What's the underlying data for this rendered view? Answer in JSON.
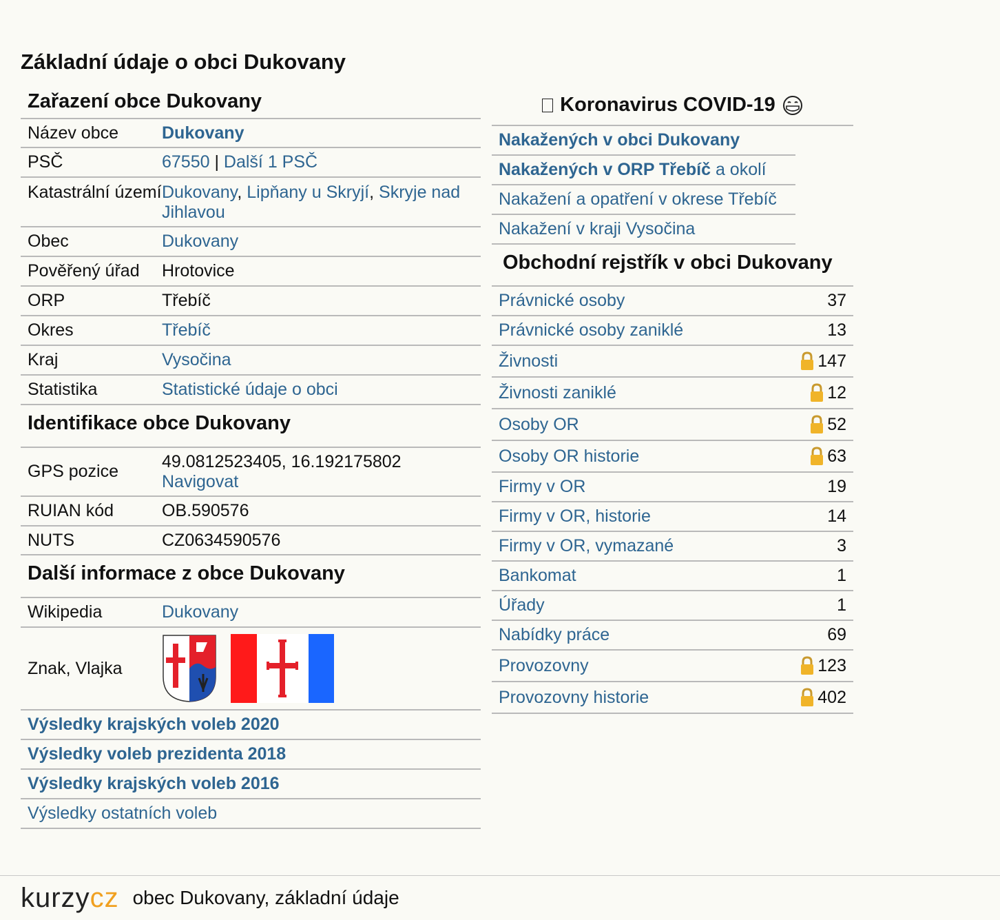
{
  "page_title": "Základní údaje o obci Dukovany",
  "zarazeni": {
    "heading": "Zařazení obce Dukovany",
    "rows": {
      "nazev": {
        "label": "Název obce",
        "value": "Dukovany"
      },
      "psc": {
        "label": "PSČ",
        "code": "67550",
        "sep": " | ",
        "more": "Další 1 PSČ"
      },
      "katastr": {
        "label": "Katastrální území",
        "a": "Dukovany",
        "b": "Lipňany u Skryjí",
        "c": "Skryje nad Jihlavou"
      },
      "obec": {
        "label": "Obec",
        "value": "Dukovany"
      },
      "poverany": {
        "label": "Pověřený úřad",
        "value": "Hrotovice"
      },
      "orp": {
        "label": "ORP",
        "value": "Třebíč"
      },
      "okres": {
        "label": "Okres",
        "value": "Třebíč"
      },
      "kraj": {
        "label": "Kraj",
        "value": "Vysočina"
      },
      "statistika": {
        "label": "Statistika",
        "value": "Statistické údaje o obci"
      }
    }
  },
  "identifikace": {
    "heading": "Identifikace obce Dukovany",
    "gps": {
      "label": "GPS pozice",
      "coords": "49.0812523405, 16.192175802",
      "link": "Navigovat"
    },
    "ruian": {
      "label": "RUIAN kód",
      "value": "OB.590576"
    },
    "nuts": {
      "label": "NUTS",
      "value": "CZ0634590576"
    }
  },
  "dalsi": {
    "heading": "Další informace z obce Dukovany",
    "wikipedia": {
      "label": "Wikipedia",
      "value": "Dukovany"
    },
    "znak": {
      "label": "Znak, Vlajka"
    }
  },
  "volby": {
    "v2020": "Výsledky krajských voleb 2020",
    "v2018": "Výsledky voleb prezidenta 2018",
    "v2016": "Výsledky krajských voleb 2016",
    "ostatni": "Výsledky ostatních voleb"
  },
  "covid": {
    "heading": "Koronavirus COVID-19",
    "icon": "face-with-medical-mask",
    "links": {
      "l1": "Nakažených v obci Dukovany",
      "l2_bold": "Nakažených v ORP Třebíč",
      "l2_rest": " a okolí",
      "l3": "Nakažení a opatření v okrese Třebíč",
      "l4": "Nakažení v kraji Vysočina"
    }
  },
  "rejstrik": {
    "heading": "Obchodní rejstřík v obci Dukovany",
    "rows": [
      {
        "label": "Právnické osoby",
        "count": "37"
      },
      {
        "label": "Právnické osoby zaniklé",
        "count": "13"
      },
      {
        "label": "Živnosti",
        "count": "147",
        "locked": true
      },
      {
        "label": "Živnosti zaniklé",
        "count": "12",
        "locked": true
      },
      {
        "label": "Osoby OR",
        "count": "52",
        "locked": true
      },
      {
        "label": "Osoby OR historie",
        "count": "63",
        "locked": true
      },
      {
        "label": "Firmy v OR",
        "count": "19"
      },
      {
        "label": "Firmy v OR, historie",
        "count": "14"
      },
      {
        "label": "Firmy v OR, vymazané",
        "count": "3"
      },
      {
        "label": "Bankomat",
        "count": "1"
      },
      {
        "label": "Úřady",
        "count": "1"
      },
      {
        "label": "Nabídky práce",
        "count": "69"
      },
      {
        "label": "Provozovny",
        "count": "123",
        "locked": true
      },
      {
        "label": "Provozovny historie",
        "count": "402",
        "locked": true
      }
    ]
  },
  "footer": {
    "logo_a": "kurzy",
    "logo_b": "cz",
    "text": "obec Dukovany, základní údaje"
  },
  "colors": {
    "link": "#2e6591",
    "background": "#fafaf5",
    "divider": "#b9b9b9",
    "lock": "#f0b429"
  }
}
